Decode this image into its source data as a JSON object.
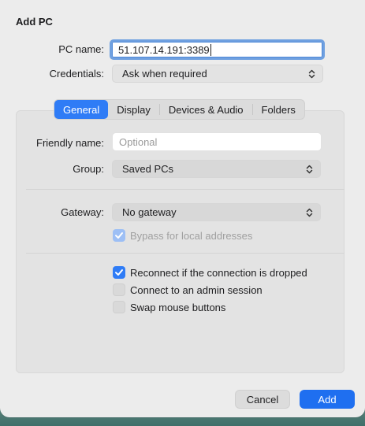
{
  "dialog": {
    "title": "Add PC",
    "pc_name_label": "PC name:",
    "pc_name_value": "51.107.14.191:3389",
    "credentials_label": "Credentials:",
    "credentials_value": "Ask when required"
  },
  "tabs": [
    {
      "label": "General",
      "active": true
    },
    {
      "label": "Display",
      "active": false
    },
    {
      "label": "Devices & Audio",
      "active": false
    },
    {
      "label": "Folders",
      "active": false
    }
  ],
  "general": {
    "friendly_name_label": "Friendly name:",
    "friendly_name_placeholder": "Optional",
    "friendly_name_value": "",
    "group_label": "Group:",
    "group_value": "Saved PCs",
    "gateway_label": "Gateway:",
    "gateway_value": "No gateway",
    "bypass_label": "Bypass for local addresses",
    "bypass_checked": true,
    "reconnect_label": "Reconnect if the connection is dropped",
    "reconnect_checked": true,
    "admin_label": "Connect to an admin session",
    "admin_checked": false,
    "swap_label": "Swap mouse buttons",
    "swap_checked": false
  },
  "footer": {
    "cancel_label": "Cancel",
    "add_label": "Add"
  },
  "colors": {
    "accent": "#2f7cf6",
    "primary_button": "#1f6ff0"
  },
  "icons": {
    "chevron": "chevron-up-down-icon",
    "check": "checkmark-icon"
  }
}
